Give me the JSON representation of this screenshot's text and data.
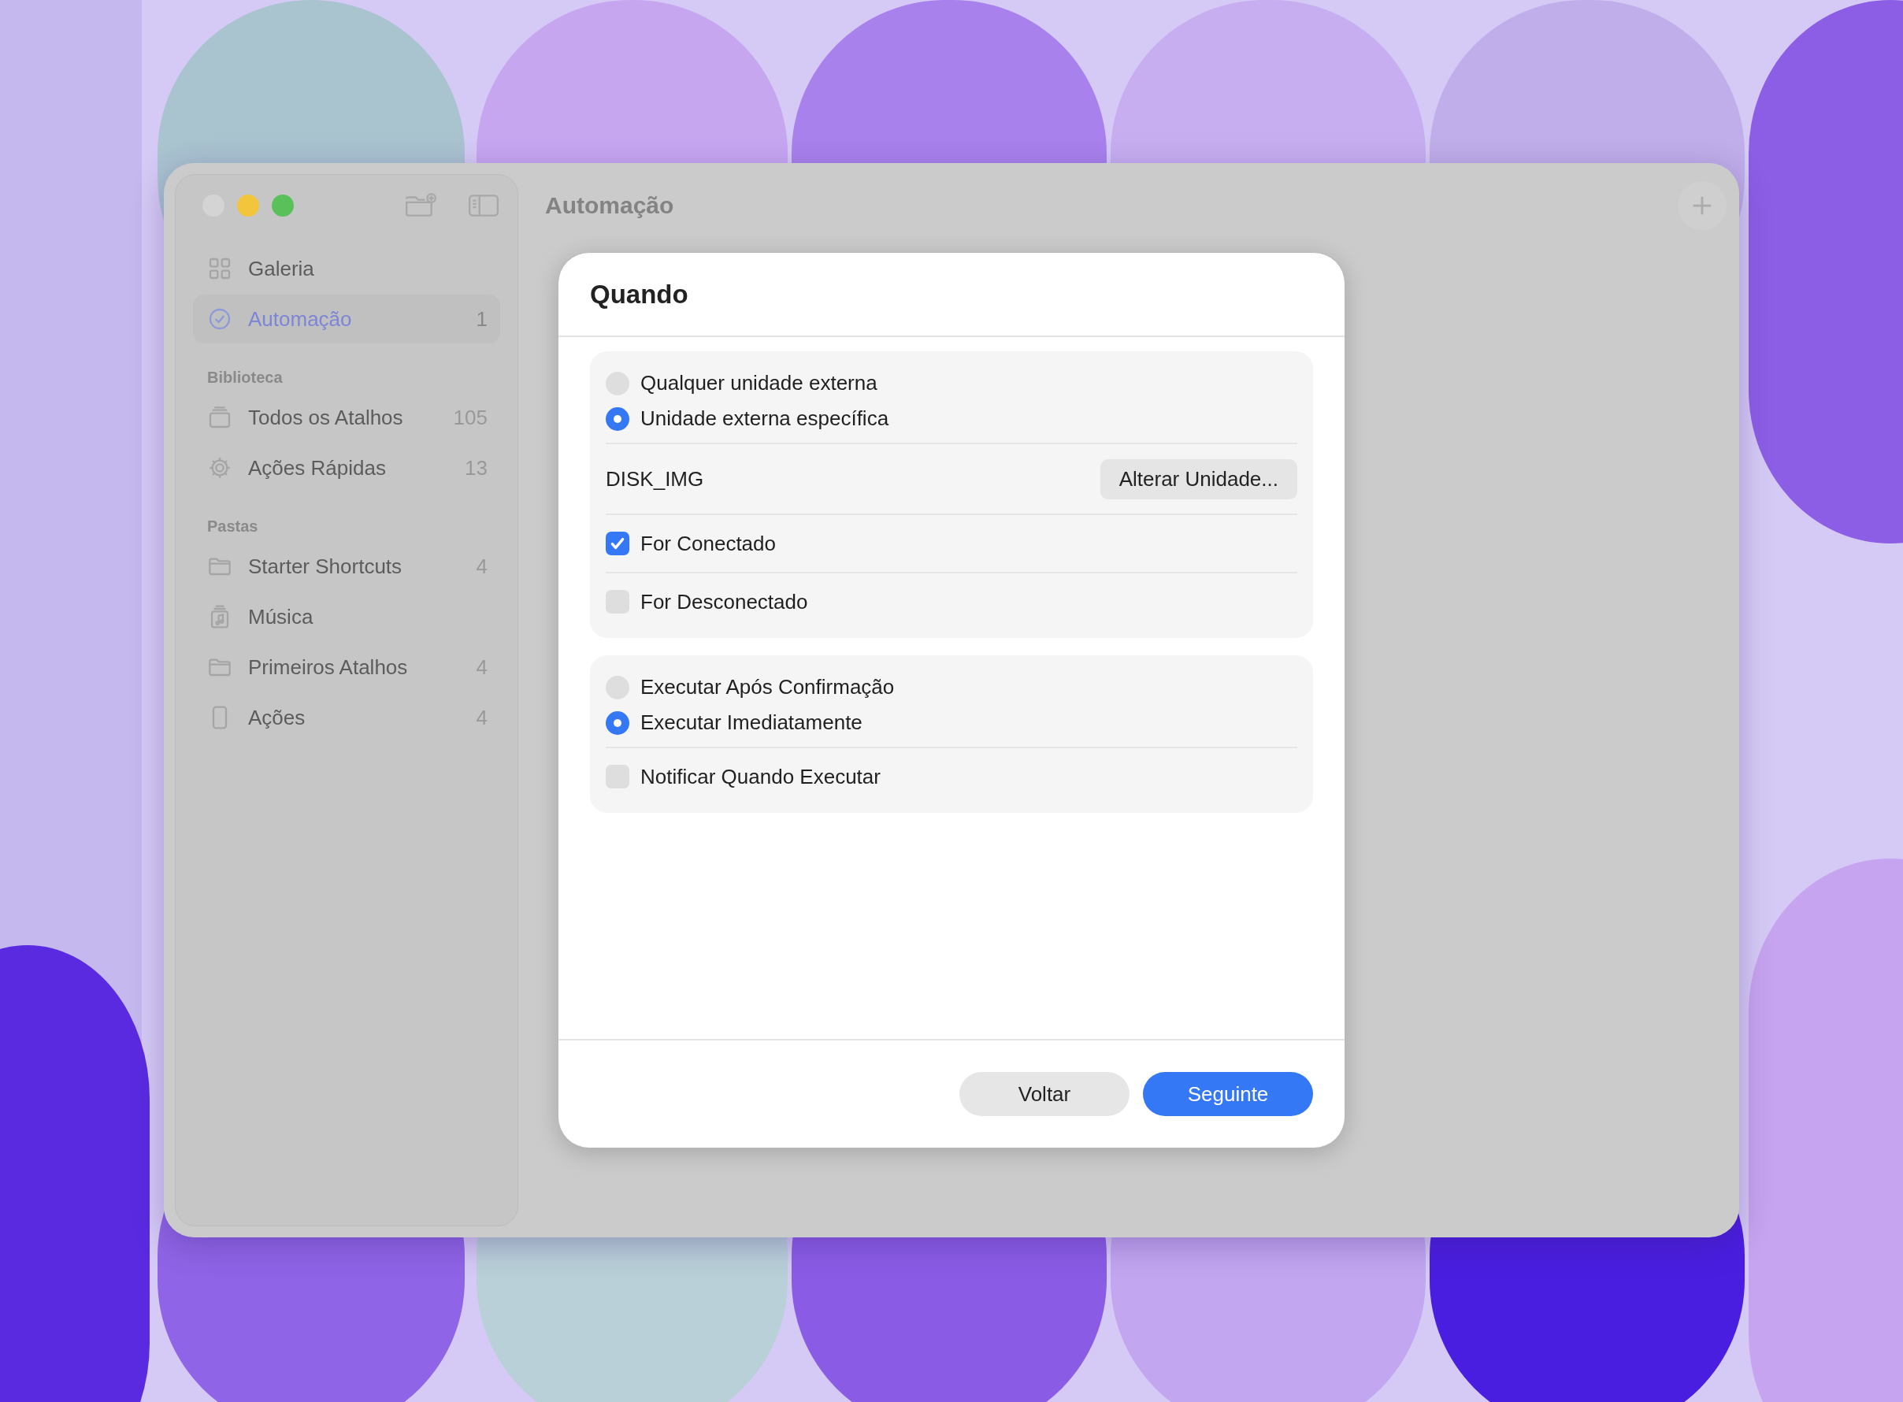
{
  "window": {
    "title": "Automação"
  },
  "sidebar": {
    "top_items": [
      {
        "label": "Galeria",
        "selected": false
      },
      {
        "label": "Automação",
        "count": "1",
        "selected": true
      }
    ],
    "sections": [
      {
        "title": "Biblioteca",
        "items": [
          {
            "label": "Todos os Atalhos",
            "count": "105",
            "selected": false
          },
          {
            "label": "Ações Rápidas",
            "count": "13",
            "selected": false
          }
        ]
      },
      {
        "title": "Pastas",
        "items": [
          {
            "label": "Starter Shortcuts",
            "count": "4",
            "selected": false
          },
          {
            "label": "Música",
            "selected": false
          },
          {
            "label": "Primeiros Atalhos",
            "count": "4",
            "selected": false
          },
          {
            "label": "Ações",
            "count": "4",
            "selected": false
          }
        ]
      }
    ]
  },
  "dialog": {
    "title": "Quando",
    "groups": [
      {
        "rows": [
          {
            "kind": "radio",
            "label": "Qualquer unidade externa",
            "selected": false
          },
          {
            "kind": "radio",
            "label": "Unidade externa específica",
            "selected": true
          },
          {
            "kind": "drive",
            "label": "DISK_IMG",
            "button": "Alterar Unidade..."
          },
          {
            "kind": "checkbox",
            "label": "For Conectado",
            "checked": true
          },
          {
            "kind": "checkbox",
            "label": "For Desconectado",
            "checked": false
          }
        ]
      },
      {
        "rows": [
          {
            "kind": "radio",
            "label": "Executar Após Confirmação",
            "selected": false
          },
          {
            "kind": "radio",
            "label": "Executar Imediatamente",
            "selected": true
          },
          {
            "kind": "checkbox",
            "label": "Notificar Quando Executar",
            "checked": false
          }
        ]
      }
    ],
    "buttons": [
      {
        "label": "Voltar",
        "primary": false
      },
      {
        "label": "Seguinte",
        "primary": true
      }
    ]
  }
}
